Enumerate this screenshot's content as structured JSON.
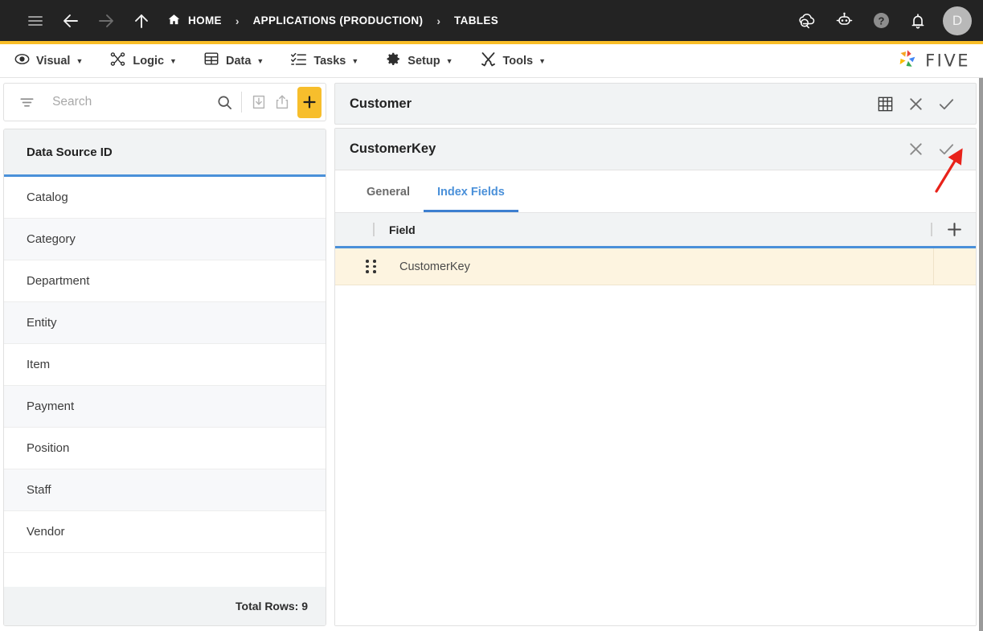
{
  "topbar": {
    "menu_icon": "hamburger-icon",
    "back_icon": "arrow-left-icon",
    "forward_icon": "arrow-right-icon",
    "up_icon": "arrow-up-icon",
    "home_icon": "home-icon",
    "breadcrumbs": [
      {
        "label": "HOME"
      },
      {
        "label": "APPLICATIONS (PRODUCTION)"
      },
      {
        "label": "TABLES"
      }
    ],
    "separator": "›",
    "right_icons": [
      {
        "name": "cloud-check-icon"
      },
      {
        "name": "chatbot-icon"
      },
      {
        "name": "help-icon"
      },
      {
        "name": "notifications-bell-icon"
      }
    ],
    "avatar_initial": "D",
    "background_color": "#232323",
    "accent_color": "#F9BE28"
  },
  "menubar": {
    "items": [
      {
        "label": "Visual",
        "icon": "eye-icon",
        "caret": "▼"
      },
      {
        "label": "Logic",
        "icon": "logic-nodes-icon",
        "caret": "▼"
      },
      {
        "label": "Data",
        "icon": "grid-icon",
        "caret": "▼"
      },
      {
        "label": "Tasks",
        "icon": "checklist-icon",
        "caret": "▼"
      },
      {
        "label": "Setup",
        "icon": "gear-icon",
        "caret": "▼"
      },
      {
        "label": "Tools",
        "icon": "tools-icon",
        "caret": "▼"
      }
    ],
    "brand_text": "FIVE"
  },
  "sidebar": {
    "search": {
      "placeholder": "Search",
      "value": "",
      "filter_icon": "filter-icon",
      "search_icon": "search-icon",
      "import_icon": "import-icon",
      "export_icon": "export-icon",
      "add_icon": "plus-icon"
    },
    "list": {
      "column_header": "Data Source ID",
      "rows": [
        {
          "label": "Catalog"
        },
        {
          "label": "Category"
        },
        {
          "label": "Department"
        },
        {
          "label": "Entity"
        },
        {
          "label": "Item"
        },
        {
          "label": "Payment"
        },
        {
          "label": "Position"
        },
        {
          "label": "Staff"
        },
        {
          "label": "Vendor"
        }
      ],
      "footer": "Total Rows: 9"
    }
  },
  "main": {
    "record_header": {
      "title": "Customer",
      "table_icon": "table-grid-icon",
      "close_icon": "close-x-icon",
      "save_icon": "checkmark-icon"
    },
    "sub_header": {
      "title": "CustomerKey",
      "close_icon": "close-x-icon",
      "save_icon": "checkmark-icon"
    },
    "tabs": [
      {
        "label": "General",
        "active": false
      },
      {
        "label": "Index Fields",
        "active": true
      }
    ],
    "field_grid": {
      "column_header": "Field",
      "add_icon": "plus-icon",
      "drag_handle_icon": "drag-handle-icon",
      "rows": [
        {
          "field": "CustomerKey",
          "highlighted": true
        }
      ]
    }
  },
  "annotation": {
    "arrow_color": "#e8221a",
    "points_to": "checkmark-icon"
  }
}
